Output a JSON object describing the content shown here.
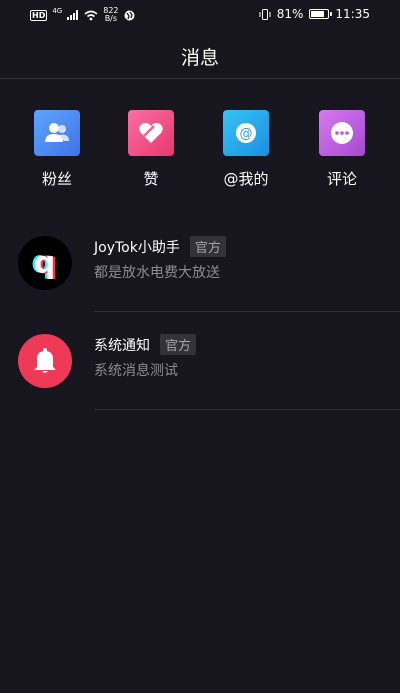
{
  "status_bar": {
    "hd": "HD",
    "network_type": "4G",
    "speed_value": "822",
    "speed_unit": "B/s",
    "battery_percent": "81%",
    "battery_level": 0.81,
    "time": "11:35"
  },
  "header": {
    "title": "消息"
  },
  "actions": [
    {
      "label": "粉丝",
      "icon": "fans-icon",
      "color": "#4a8df0"
    },
    {
      "label": "赞",
      "icon": "heart-icon",
      "color": "#f0508a"
    },
    {
      "label": "@我的",
      "icon": "at-icon",
      "color": "#2aa9ec"
    },
    {
      "label": "评论",
      "icon": "comment-icon",
      "color": "#b75ad8"
    }
  ],
  "messages": [
    {
      "name": "JoyTok小助手",
      "badge": "官方",
      "preview": "都是放水电费大放送",
      "avatar": "joytok-logo-icon",
      "avatar_color": "#000000"
    },
    {
      "name": "系统通知",
      "badge": "官方",
      "preview": "系统消息测试",
      "avatar": "bell-icon",
      "avatar_color": "#ee3a56"
    }
  ],
  "colors": {
    "background": "#17161e",
    "muted_text": "#8b8a93",
    "divider": "#2e2d35"
  }
}
